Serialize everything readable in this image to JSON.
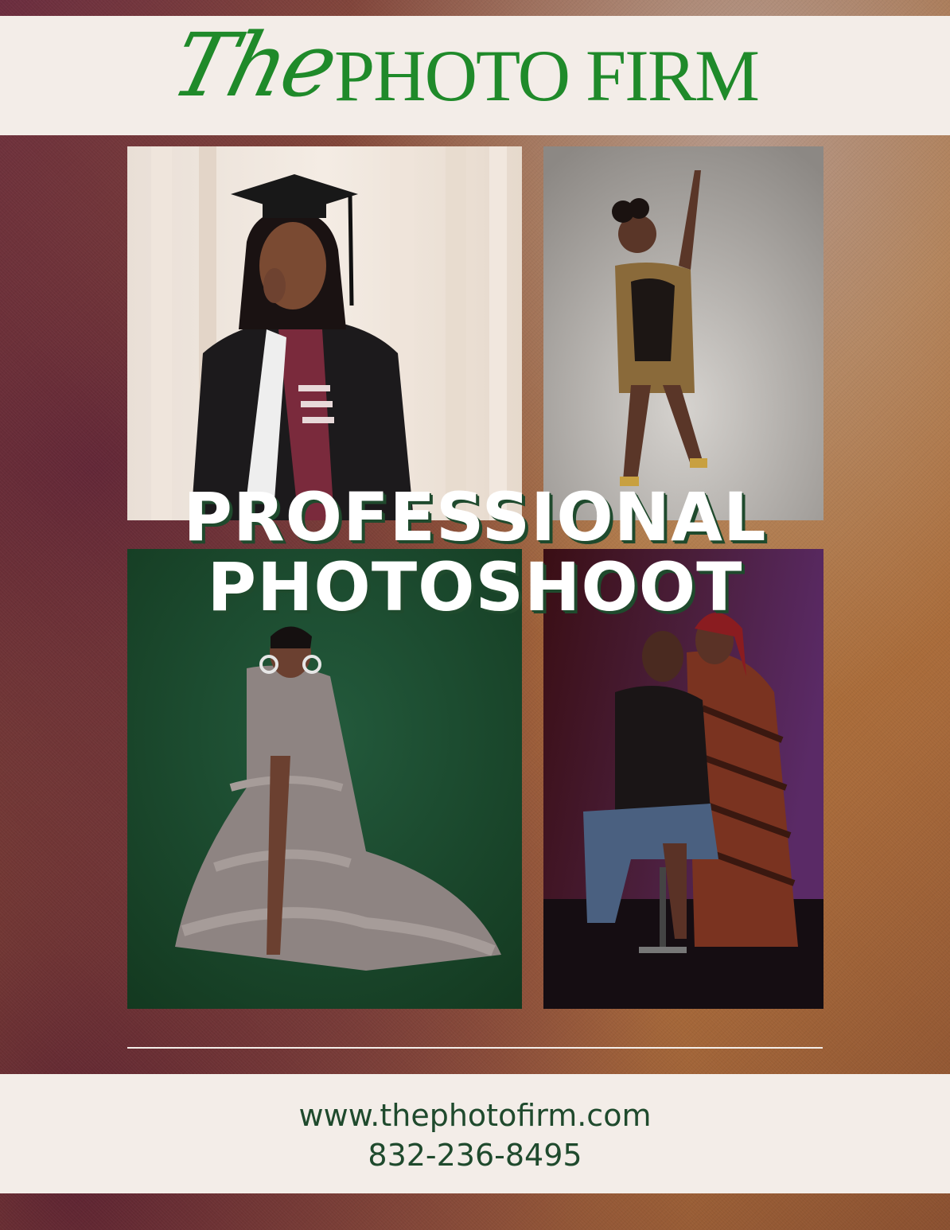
{
  "logo": {
    "script_word": "The",
    "name": "PHOTO FIRM",
    "color": "#1f8a2a"
  },
  "headline": {
    "line1": "PROFESSIONAL",
    "line2": "PHOTOSHOOT",
    "text_color": "#ffffff",
    "shadow_color": "#1f4a2d"
  },
  "photos": [
    {
      "subject": "graduate-portrait"
    },
    {
      "subject": "dancer-portrait"
    },
    {
      "subject": "maternity-portrait"
    },
    {
      "subject": "couple-portrait"
    }
  ],
  "contact": {
    "website": "www.thephotofirm.com",
    "phone": "832-236-8495",
    "text_color": "#1f4a2d"
  },
  "colors": {
    "band": "#f3ede8",
    "brand_green": "#1f8a2a"
  }
}
